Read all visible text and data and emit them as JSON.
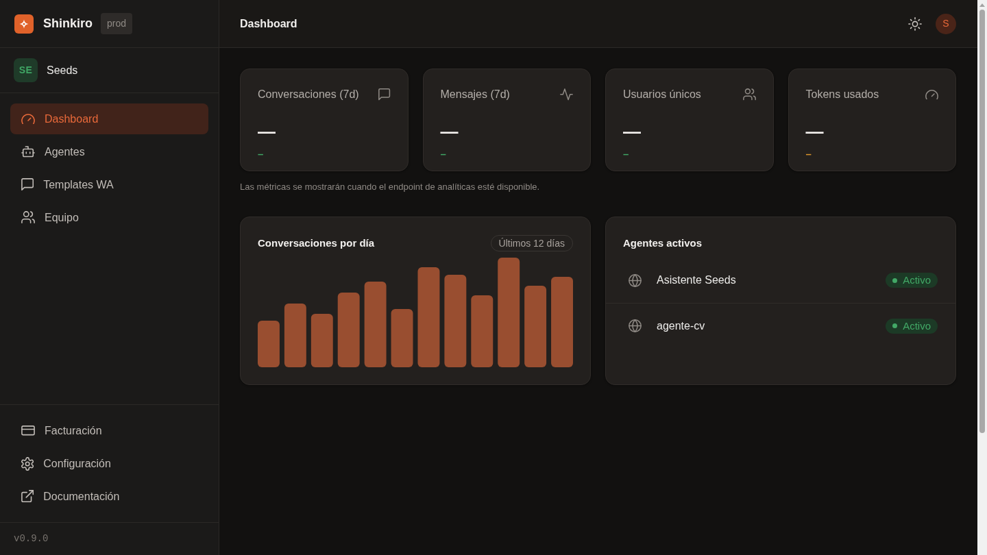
{
  "sidebar": {
    "brand": {
      "name": "Shinkiro",
      "environment": "prod"
    },
    "workspace": {
      "initials": "SE",
      "name": "Seeds"
    },
    "nav": [
      {
        "label": "Dashboard",
        "selected": true
      },
      {
        "label": "Agentes",
        "selected": false
      },
      {
        "label": "Templates WA",
        "selected": false
      },
      {
        "label": "Equipo",
        "selected": false
      }
    ],
    "footer_nav": [
      {
        "label": "Facturación",
        "selected": false
      },
      {
        "label": "Configuración",
        "selected": false
      },
      {
        "label": "Documentación",
        "selected": false
      }
    ],
    "version": "v0.9.0"
  },
  "header": {
    "title": "Dashboard",
    "avatar": "S"
  },
  "stats": [
    {
      "title": "Conversaciones (7d)",
      "value": "—",
      "delta": "–",
      "color": "#3fa564"
    },
    {
      "title": "Mensajes (7d)",
      "value": "—",
      "delta": "–",
      "color": "#3fa564"
    },
    {
      "title": "Usuarios únicos",
      "value": "—",
      "delta": "–",
      "color": "#3fa564"
    },
    {
      "title": "Tokens usados",
      "value": "—",
      "delta": "–",
      "color": "#d9952b"
    }
  ],
  "stats_note": "Las métricas se mostrarán cuando el endpoint de analíticas esté disponible.",
  "chart_card": {
    "title": "Conversaciones por día",
    "range": "Últimos 12 días"
  },
  "agents_card": {
    "title": "Agentes activos",
    "agents": [
      {
        "name": "Asistente Seeds",
        "status": "Activo"
      },
      {
        "name": "agente-cv",
        "status": "Activo"
      }
    ]
  }
}
